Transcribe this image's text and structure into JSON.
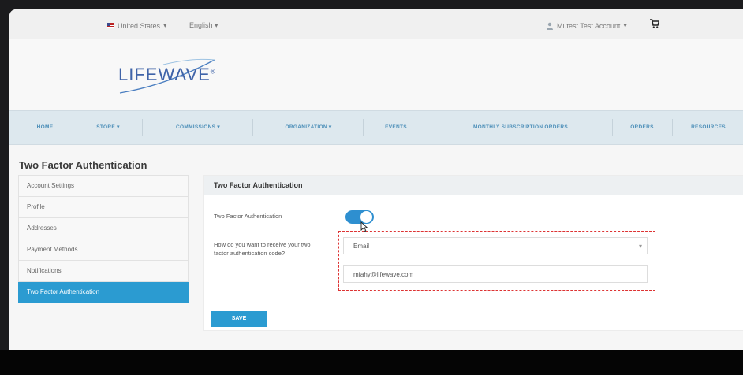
{
  "topbar": {
    "country": "United States",
    "country_caret": "▾",
    "language": "English",
    "language_caret": "▾",
    "account": "Mutest Test Account",
    "account_caret": "▾"
  },
  "brand": {
    "logo_text": "LIFEWAVE",
    "logo_mark": "®"
  },
  "nav": {
    "items": [
      {
        "label": "HOME"
      },
      {
        "label": "STORE ▾"
      },
      {
        "label": "COMMISSIONS ▾"
      },
      {
        "label": "ORGANIZATION ▾"
      },
      {
        "label": "EVENTS"
      },
      {
        "label": "MONTHLY SUBSCRIPTION ORDERS"
      },
      {
        "label": "ORDERS"
      },
      {
        "label": "RESOURCES"
      }
    ]
  },
  "page": {
    "title": "Two Factor Authentication"
  },
  "sidebar": {
    "items": [
      {
        "label": "Account Settings"
      },
      {
        "label": "Profile"
      },
      {
        "label": "Addresses"
      },
      {
        "label": "Payment Methods"
      },
      {
        "label": "Notifications"
      },
      {
        "label": "Two Factor Authentication"
      }
    ],
    "active_index": 5
  },
  "panel": {
    "header": "Two Factor Authentication",
    "tfa_label": "Two Factor Authentication",
    "tfa_enabled": true,
    "method_label": "How do you want to receive your two factor authentication code?",
    "method_value": "Email",
    "email_value": "mfahy@lifewave.com",
    "save_label": "SAVE"
  },
  "colors": {
    "accent": "#2b9bd1",
    "toggle_on": "#2e8fd0",
    "nav_bg": "#dde8ee",
    "highlight_border": "#dd3333"
  }
}
